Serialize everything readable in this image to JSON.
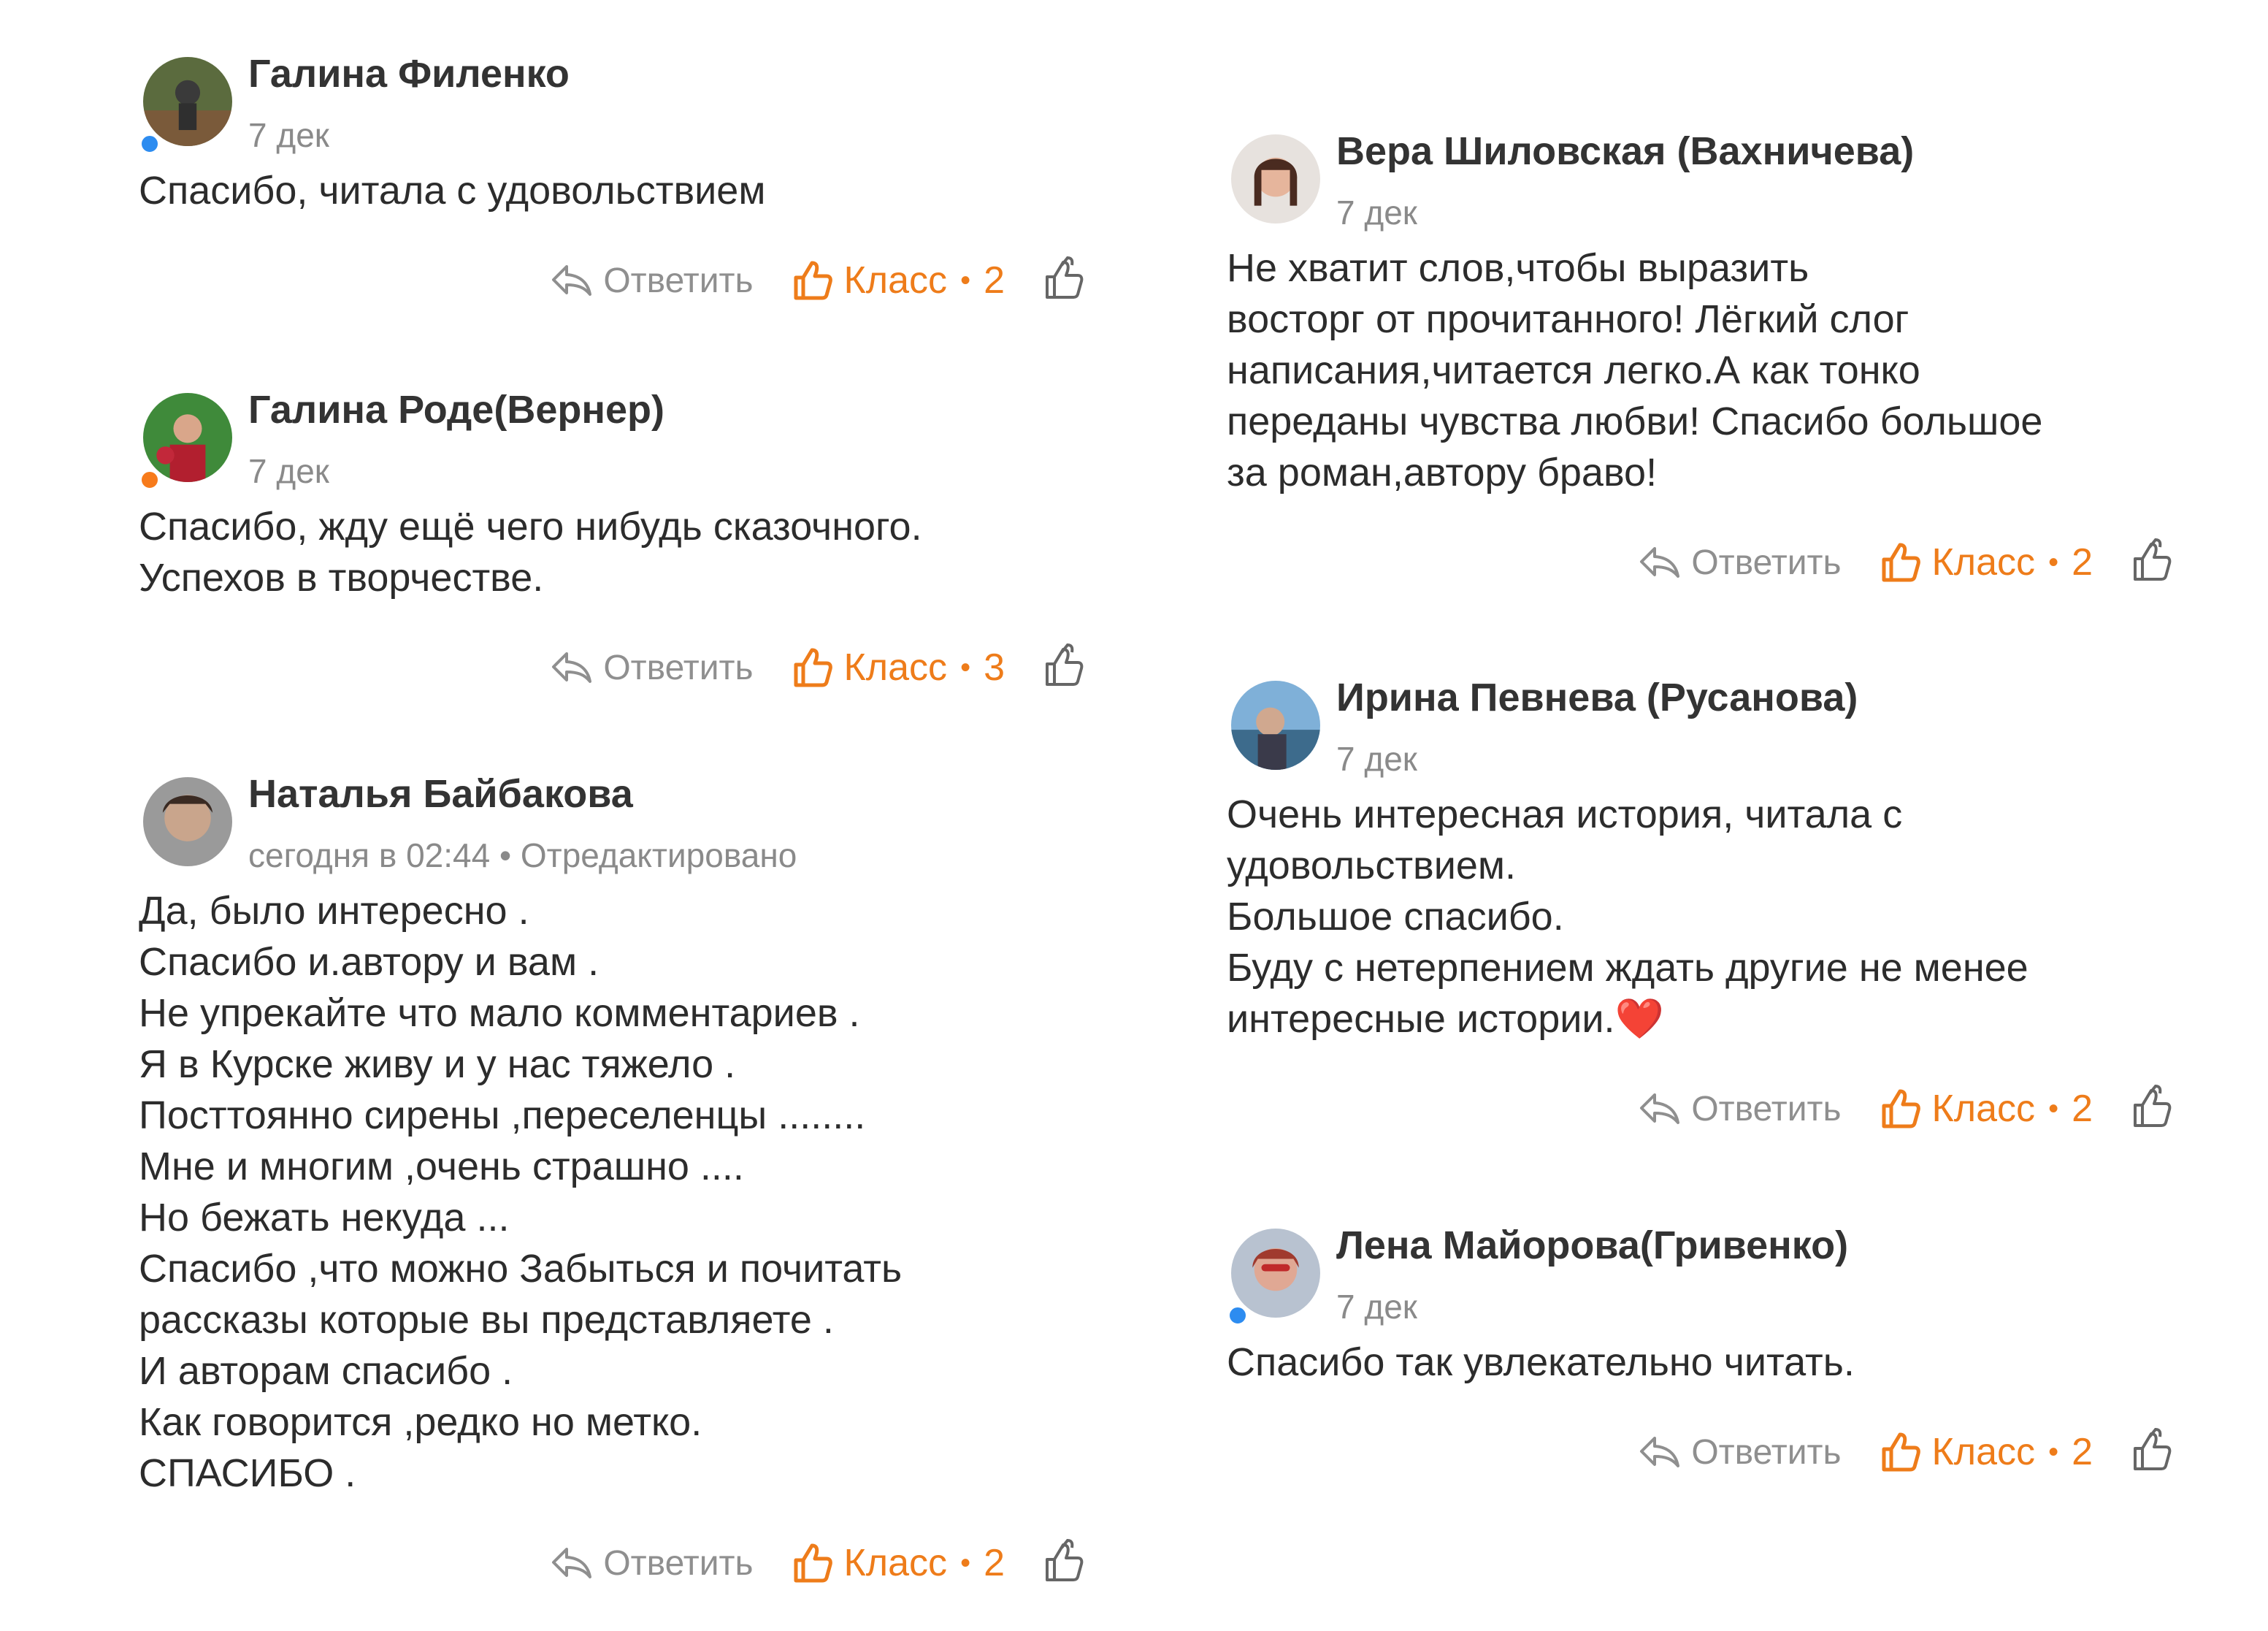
{
  "actions": {
    "reply_label": "Ответить",
    "like_label": "Класс",
    "separator": "•"
  },
  "comments": [
    {
      "author": "Галина Филенко",
      "date": "7 дек",
      "text": "Спасибо, читала с удовольствием",
      "likes": "2",
      "status": "online-blue"
    },
    {
      "author": "Галина Роде(Вернер)",
      "date": "7 дек",
      "text": "Спасибо, жду ещё чего нибудь сказочного.\nУспехов в творчестве.",
      "likes": "3",
      "status": "online-orange"
    },
    {
      "author": "Наталья Байбакова",
      "date": "сегодня в 02:44 • Отредактировано",
      "text": "Да, было интересно .\nСпасибо и.автору и вам .\nНе упрекайте что мало комментариев .\nЯ в Курске живу и у нас тяжело .\nПосттоянно сирены ,переселенцы ........\nМне и многим ,очень страшно ....\nНо бежать некуда ...\nСпасибо ,что можно Забыться и почитать\nрассказы которые вы представляете .\nИ авторам спасибо .\nКак говорится ,редко но метко.\nСПАСИБО .",
      "likes": "2",
      "status": ""
    },
    {
      "author": "Вера Шиловская (Вахничева)",
      "date": "7 дек",
      "text": "Не хватит слов,чтобы выразить\nвосторг от прочитанного! Лёгкий слог\nнаписания,читается легко.А как тонко\nпереданы чувства любви! Спасибо большое\nза роман,автору браво!",
      "likes": "2",
      "status": ""
    },
    {
      "author": "Ирина Певнева (Русанова)",
      "date": "7 дек",
      "text": "Очень интересная история, читала с\nудовольствием.\nБольшое спасибо.\nБуду с нетерпением ждать другие не менее\nинтересные истории.❤️",
      "likes": "2",
      "status": ""
    },
    {
      "author": "Лена Майорова(Гривенко)",
      "date": "7 дек",
      "text": "Спасибо так увлекательно читать.",
      "likes": "2",
      "status": "online-blue"
    }
  ]
}
